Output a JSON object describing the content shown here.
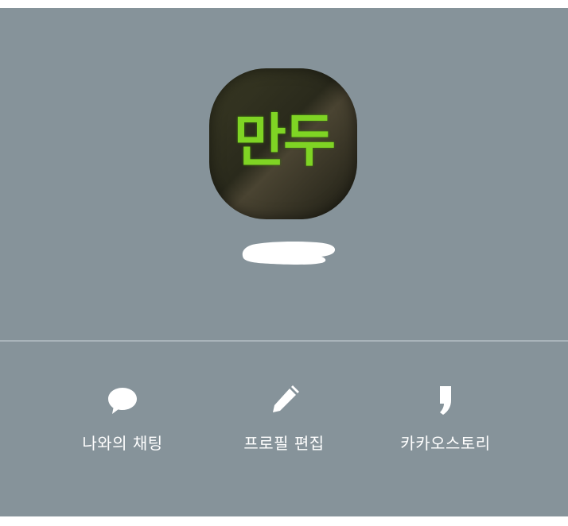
{
  "profile": {
    "avatar_text": "만두",
    "name_redacted": true
  },
  "actions": [
    {
      "label": "나와의 채팅",
      "icon": "speech-bubble-icon"
    },
    {
      "label": "프로필 편집",
      "icon": "pencil-icon"
    },
    {
      "label": "카카오스토리",
      "icon": "comma-icon"
    }
  ],
  "colors": {
    "background": "#86939a",
    "avatar_text": "#7fd424",
    "label": "#ffffff"
  }
}
